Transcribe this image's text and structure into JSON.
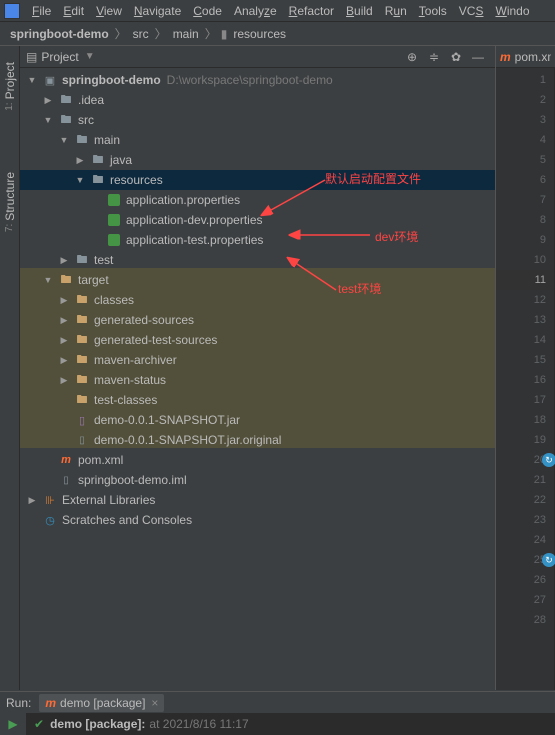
{
  "menubar": {
    "items": [
      "File",
      "Edit",
      "View",
      "Navigate",
      "Code",
      "Analyze",
      "Refactor",
      "Build",
      "Run",
      "Tools",
      "VCS",
      "Window"
    ]
  },
  "breadcrumb": {
    "root": "springboot-demo",
    "parts": [
      "src",
      "main",
      "resources"
    ]
  },
  "projectPanel": {
    "title": "Project",
    "tree": [
      {
        "depth": 0,
        "arrow": "down",
        "icon": "module",
        "label": "springboot-demo",
        "bold": true,
        "path": "D:\\workspace\\springboot-demo"
      },
      {
        "depth": 1,
        "arrow": "right",
        "icon": "folder",
        "label": ".idea"
      },
      {
        "depth": 1,
        "arrow": "down",
        "icon": "folder",
        "label": "src"
      },
      {
        "depth": 2,
        "arrow": "down",
        "icon": "folder",
        "label": "main"
      },
      {
        "depth": 3,
        "arrow": "right",
        "icon": "folder",
        "label": "java"
      },
      {
        "depth": 3,
        "arrow": "down",
        "icon": "resources",
        "label": "resources",
        "selected": true
      },
      {
        "depth": 4,
        "arrow": "",
        "icon": "prop",
        "label": "application.properties"
      },
      {
        "depth": 4,
        "arrow": "",
        "icon": "prop",
        "label": "application-dev.properties"
      },
      {
        "depth": 4,
        "arrow": "",
        "icon": "prop",
        "label": "application-test.properties"
      },
      {
        "depth": 2,
        "arrow": "right",
        "icon": "folder",
        "label": "test"
      },
      {
        "depth": 1,
        "arrow": "down",
        "icon": "folder-orange",
        "label": "target",
        "targetStart": true
      },
      {
        "depth": 2,
        "arrow": "right",
        "icon": "folder-orange",
        "label": "classes"
      },
      {
        "depth": 2,
        "arrow": "right",
        "icon": "folder-orange",
        "label": "generated-sources"
      },
      {
        "depth": 2,
        "arrow": "right",
        "icon": "folder-orange",
        "label": "generated-test-sources"
      },
      {
        "depth": 2,
        "arrow": "right",
        "icon": "folder-orange",
        "label": "maven-archiver"
      },
      {
        "depth": 2,
        "arrow": "right",
        "icon": "folder-orange",
        "label": "maven-status"
      },
      {
        "depth": 2,
        "arrow": "",
        "icon": "folder-orange",
        "label": "test-classes"
      },
      {
        "depth": 2,
        "arrow": "",
        "icon": "jar",
        "label": "demo-0.0.1-SNAPSHOT.jar"
      },
      {
        "depth": 2,
        "arrow": "",
        "icon": "file",
        "label": "demo-0.0.1-SNAPSHOT.jar.original",
        "targetEnd": true
      },
      {
        "depth": 1,
        "arrow": "",
        "icon": "maven",
        "label": "pom.xml"
      },
      {
        "depth": 1,
        "arrow": "",
        "icon": "file",
        "label": "springboot-demo.iml"
      },
      {
        "depth": 0,
        "arrow": "right",
        "icon": "lib",
        "label": "External Libraries"
      },
      {
        "depth": 0,
        "arrow": "",
        "icon": "scratch",
        "label": "Scratches and Consoles"
      }
    ]
  },
  "sidebarTabs": {
    "project": {
      "num": "1:",
      "label": "Project"
    },
    "structure": {
      "num": "7:",
      "label": "Structure"
    }
  },
  "editor": {
    "tabName": "pom.xml",
    "lines": 28,
    "currentLine": 11,
    "hintLines": [
      20,
      25
    ]
  },
  "run": {
    "label": "Run:",
    "config": "demo [package]",
    "outputPrefix": "demo [package]:",
    "outputTime": "at 2021/8/16 11:17"
  },
  "annotations": {
    "a1": "默认启动配置文件",
    "a2": "dev环境",
    "a3": "test环境"
  }
}
